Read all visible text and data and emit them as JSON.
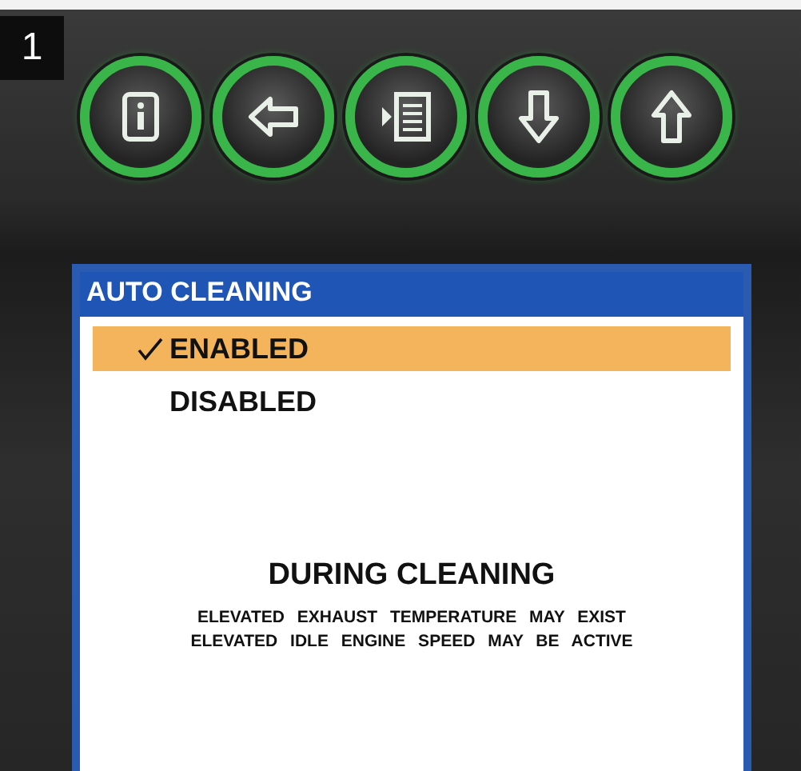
{
  "step_badge": "1",
  "buttons": [
    {
      "kind": "info"
    },
    {
      "kind": "back"
    },
    {
      "kind": "menu"
    },
    {
      "kind": "down"
    },
    {
      "kind": "up"
    }
  ],
  "screen": {
    "title": "AUTO CLEANING",
    "options": [
      {
        "label": "ENABLED",
        "selected": true
      },
      {
        "label": "DISABLED",
        "selected": false
      }
    ],
    "heading": "DURING CLEANING",
    "notes": [
      "ELEVATED EXHAUST TEMPERATURE MAY EXIST",
      "ELEVATED IDLE ENGINE SPEED MAY BE ACTIVE"
    ]
  }
}
